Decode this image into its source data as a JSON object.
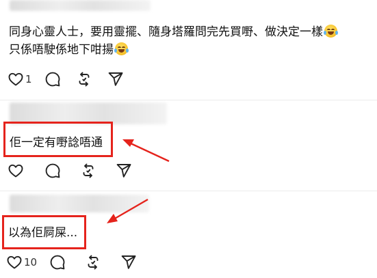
{
  "posts": [
    {
      "text_line1": "同身心靈人士，要用靈擺、隨身塔羅問完先買嘢、做決定一樣",
      "emoji1": "grinning-squinting-face-with-tears",
      "text_line2": "只係唔駛係地下咁揚",
      "emoji2": "grinning-squinting-face-with-tears",
      "like_count": "1"
    },
    {
      "text": "佢一定有嘢諗唔通",
      "like_count": ""
    },
    {
      "text": "以為佢屙屎...",
      "like_count": "10"
    }
  ],
  "actions": {
    "like_icon": "heart-icon",
    "reply_icon": "comment-bubble-icon",
    "repost_icon": "repost-arrows-icon",
    "share_icon": "send-paper-plane-icon"
  },
  "colors": {
    "annotation_red": "#e5231c",
    "text": "#111111",
    "icon": "#222222"
  }
}
